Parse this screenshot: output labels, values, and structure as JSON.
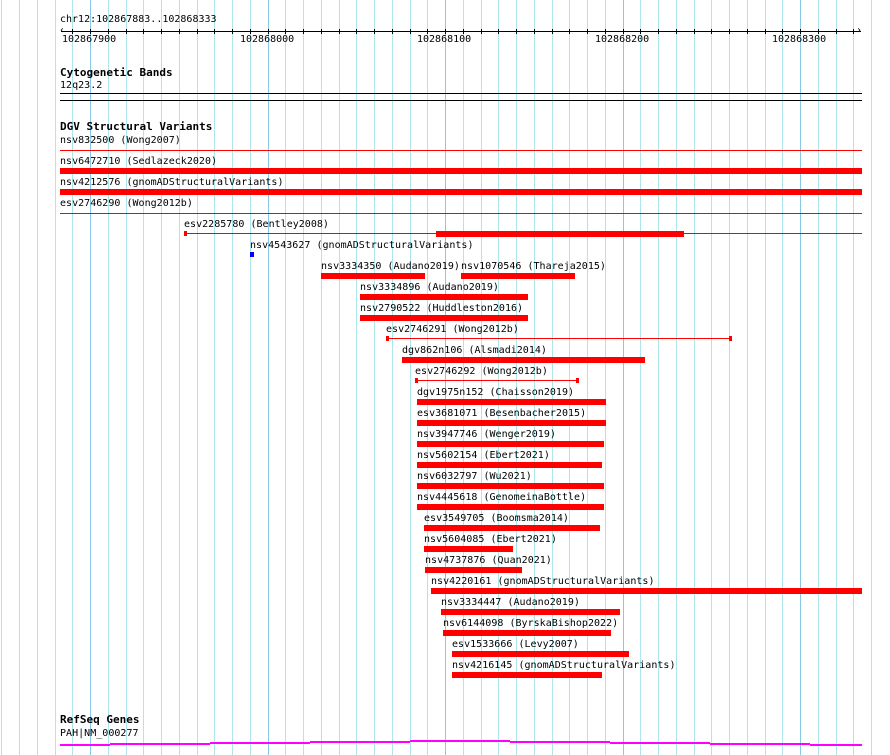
{
  "ruler": {
    "location": "chr12:102867883..102868333",
    "tick_labels": [
      "102867900",
      "102868000",
      "102868100",
      "102868200",
      "102868300"
    ]
  },
  "tracks": {
    "cytobands": {
      "title": "Cytogenetic Bands",
      "band": "12q23.2"
    },
    "dgv": {
      "title": "DGV Structural Variants",
      "features": [
        {
          "label": "nsv832500 (Wong2007)"
        },
        {
          "label": "nsv6472710 (Sedlazeck2020)"
        },
        {
          "label": "nsv4212576 (gnomADStructuralVariants)"
        },
        {
          "label": "esv2746290 (Wong2012b)"
        },
        {
          "label": "esv2285780 (Bentley2008)"
        },
        {
          "label": "nsv4543627 (gnomADStructuralVariants)"
        },
        {
          "label": "nsv3334350 (Audano2019)"
        },
        {
          "label": "nsv1070546 (Thareja2015)"
        },
        {
          "label": "nsv3334896 (Audano2019)"
        },
        {
          "label": "nsv2790522 (Huddleston2016)"
        },
        {
          "label": "esv2746291 (Wong2012b)"
        },
        {
          "label": "dgv862n106 (Alsmadi2014)"
        },
        {
          "label": "esv2746292 (Wong2012b)"
        },
        {
          "label": "dgv1975n152 (Chaisson2019)"
        },
        {
          "label": "esv3681071 (Besenbacher2015)"
        },
        {
          "label": "nsv3947746 (Wenger2019)"
        },
        {
          "label": "nsv5602154 (Ebert2021)"
        },
        {
          "label": "nsv6032797 (Wu2021)"
        },
        {
          "label": "nsv4445618 (GenomeinaBottle)"
        },
        {
          "label": "esv3549705 (Boomsma2014)"
        },
        {
          "label": "nsv5604085 (Ebert2021)"
        },
        {
          "label": "nsv4737876 (Quan2021)"
        },
        {
          "label": "nsv4220161 (gnomADStructuralVariants)"
        },
        {
          "label": "nsv3334447 (Audano2019)"
        },
        {
          "label": "nsv6144098 (ByrskaBishop2022)"
        },
        {
          "label": "esv1533666 (Levy2007)"
        },
        {
          "label": "nsv4216145 (gnomADStructuralVariants)"
        }
      ]
    },
    "refseq": {
      "title": "RefSeq Genes",
      "gene": "PAH|NM_000277"
    }
  },
  "colors": {
    "variant": "#ff0000",
    "variant_alt": "#0000ff",
    "gene": "#ff00ff",
    "grid": "#aee6ee",
    "grid_major": "#86c8e6"
  }
}
